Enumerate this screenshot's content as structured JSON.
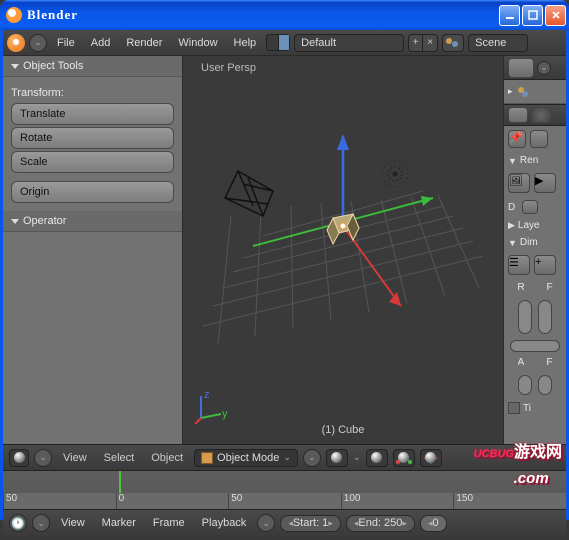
{
  "window": {
    "title": "Blender"
  },
  "topbar": {
    "menus": [
      "File",
      "Add",
      "Render",
      "Window",
      "Help"
    ],
    "layout_label": "Default",
    "scene_label": "Scene"
  },
  "tool_panel": {
    "title": "Object Tools",
    "transform_label": "Transform:",
    "buttons": {
      "translate": "Translate",
      "rotate": "Rotate",
      "scale": "Scale",
      "origin": "Origin"
    },
    "operator_label": "Operator"
  },
  "viewport": {
    "view_label": "User Persp",
    "object_label": "(1) Cube",
    "header": {
      "menus": [
        "View",
        "Select",
        "Object"
      ],
      "mode": "Object Mode"
    }
  },
  "props": {
    "sections": [
      "Ren",
      "D",
      "Laye",
      "Dim"
    ],
    "rf_labels": {
      "r": "R",
      "f": "F",
      "a": "A",
      "ti": "Ti"
    }
  },
  "timeline": {
    "menus": [
      "View",
      "Marker",
      "Frame",
      "Playback"
    ],
    "ticks": [
      "50",
      "0",
      "50",
      "100",
      "150"
    ],
    "start_label": "Start: 1",
    "end_label": "End: 250",
    "current": "0"
  },
  "watermark": {
    "brand": "UCBUG",
    "cn": "游戏网",
    "domain": ".com"
  }
}
